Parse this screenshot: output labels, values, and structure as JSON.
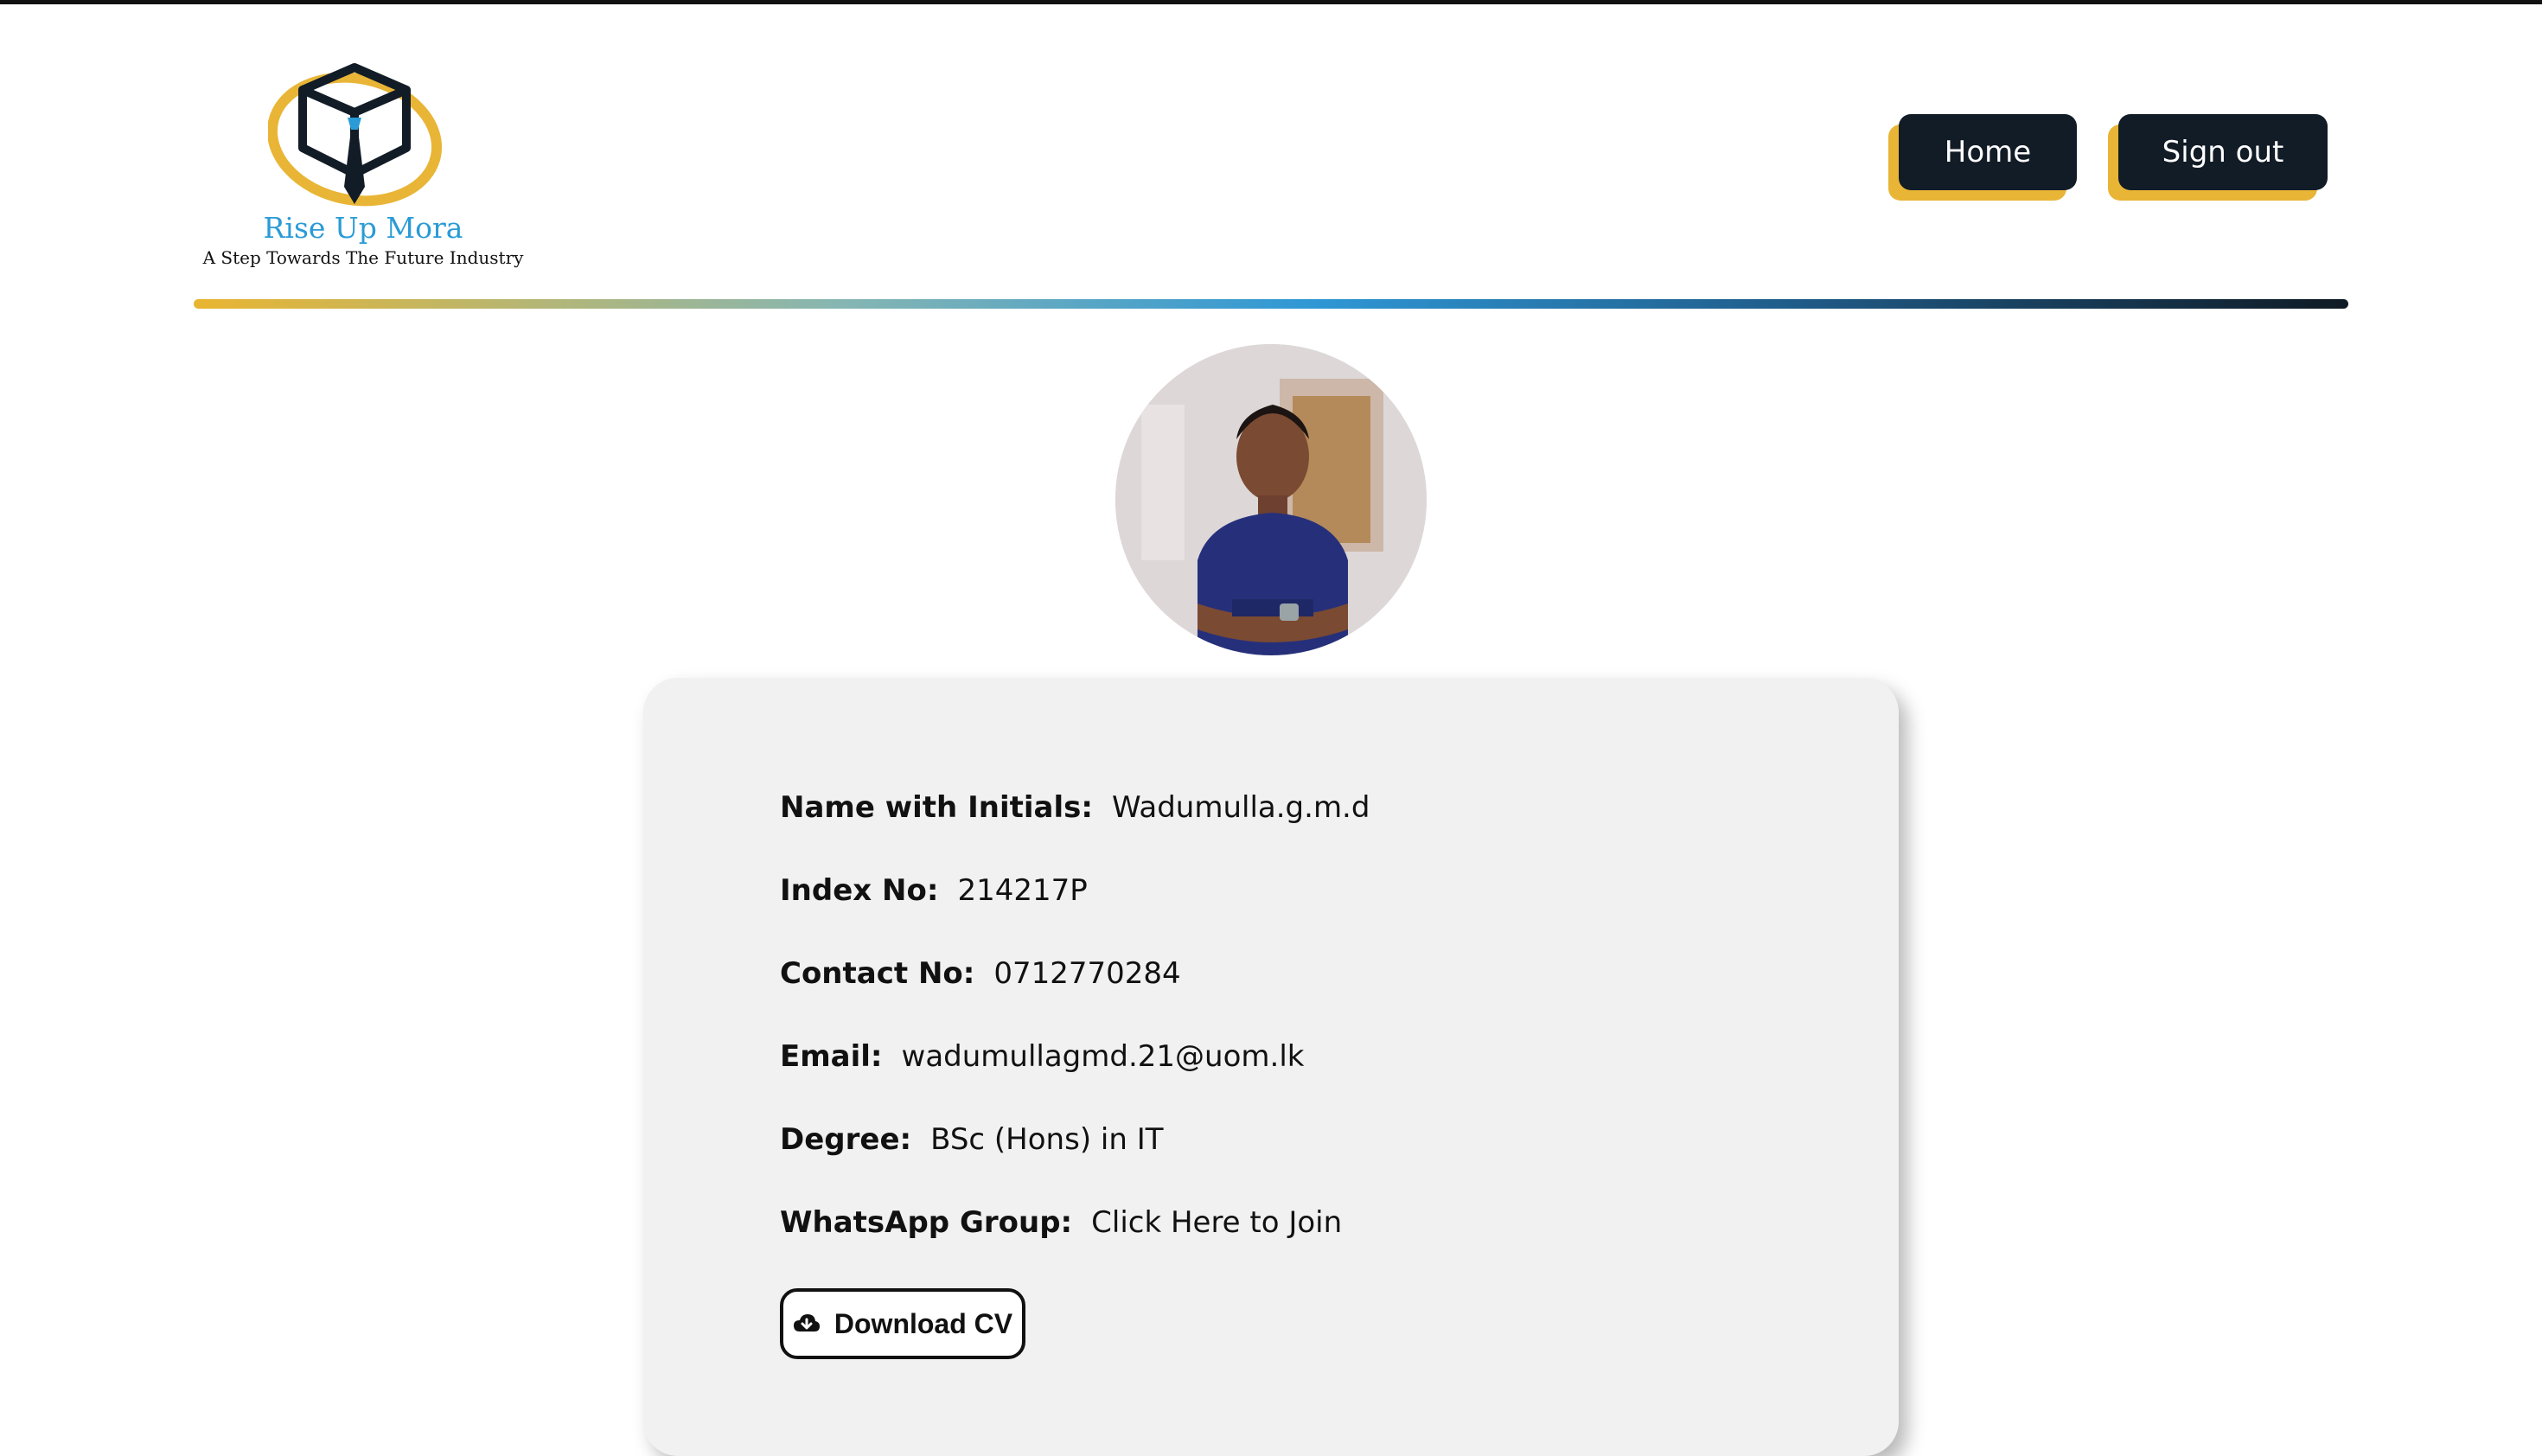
{
  "brand": {
    "name": "Rise Up Mora",
    "tagline": "A Step Towards The Future Industry"
  },
  "nav": {
    "home_label": "Home",
    "signout_label": "Sign out"
  },
  "profile": {
    "fields": [
      {
        "label": "Name with Initials:",
        "value": "Wadumulla.g.m.d"
      },
      {
        "label": "Index No:",
        "value": "214217P"
      },
      {
        "label": "Contact No:",
        "value": "0712770284"
      },
      {
        "label": "Email:",
        "value": "wadumullagmd.21@uom.lk"
      },
      {
        "label": "Degree:",
        "value": "BSc (Hons) in IT"
      },
      {
        "label": "WhatsApp Group:",
        "value": "Click Here to Join"
      }
    ],
    "download_label": "Download CV"
  },
  "icons": {
    "logo": "graduation-box-tie-logo",
    "download": "cloud-download-icon"
  },
  "colors": {
    "accent_yellow": "#e9b536",
    "dark_navy": "#121c26",
    "brand_blue": "#2a9bd6",
    "card_bg": "#f1f1f1"
  }
}
